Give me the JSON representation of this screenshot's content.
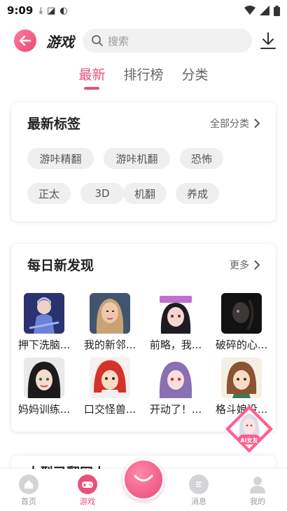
{
  "status_bar": {
    "time": "9:09"
  },
  "header": {
    "logo_text": "游戏",
    "search_placeholder": "搜索"
  },
  "tabs": [
    {
      "label": "最新",
      "active": true
    },
    {
      "label": "排行榜",
      "active": false
    },
    {
      "label": "分类",
      "active": false
    }
  ],
  "latest_tags": {
    "title": "最新标签",
    "more": "全部分类",
    "tags": [
      "游咔精翻",
      "游咔机翻",
      "恐怖",
      "正太",
      "3D",
      "机翻",
      "养成"
    ]
  },
  "daily": {
    "title": "每日新发现",
    "more": "更多",
    "games": [
      {
        "name": "押下洗脑...",
        "thumb": "blue-armor-girl"
      },
      {
        "name": "我的新邻...",
        "thumb": "blonde-3d-girl"
      },
      {
        "name": "前略，我...",
        "thumb": "black-hair-maid"
      },
      {
        "name": "破碎的心...",
        "thumb": "dark-figure"
      },
      {
        "name": "妈妈训练...",
        "thumb": "dark-hair-woman"
      },
      {
        "name": "口交怪兽...",
        "thumb": "red-hair-girl"
      },
      {
        "name": "开动了！...",
        "thumb": "purple-hair-girl"
      },
      {
        "name": "格斗娘没...",
        "thumb": "brown-hair-girl"
      }
    ]
  },
  "next_section_title": "大型已翻网上",
  "ai_badge": {
    "text": "AI女友"
  },
  "bottom_nav": [
    {
      "label": "首页",
      "active": false
    },
    {
      "label": "游戏",
      "active": true
    },
    {
      "label": "消息",
      "active": false
    },
    {
      "label": "我的",
      "active": false
    }
  ],
  "colors": {
    "accent": "#e8527a"
  }
}
